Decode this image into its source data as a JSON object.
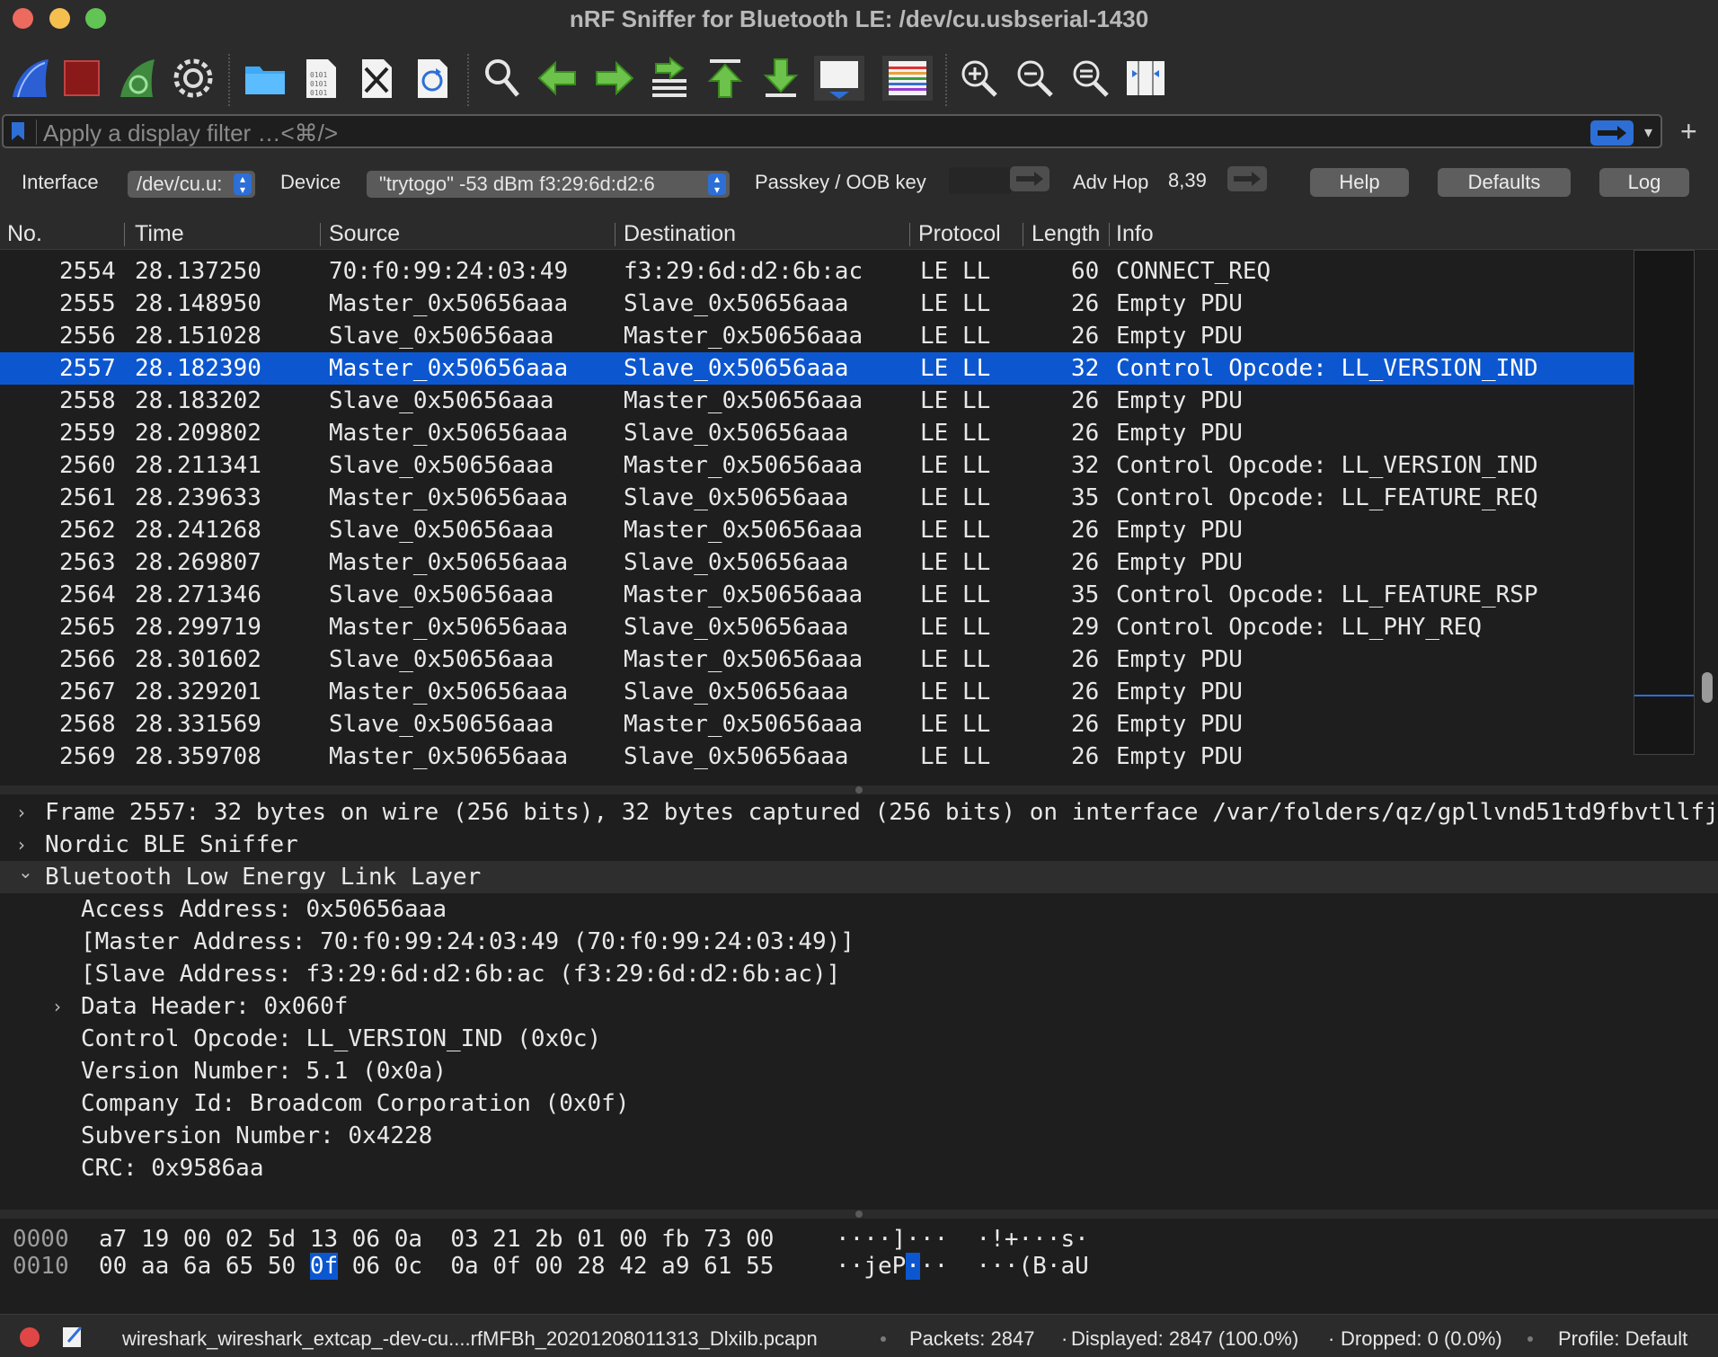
{
  "window": {
    "title": "nRF Sniffer for Bluetooth LE: /dev/cu.usbserial-1430"
  },
  "toolbar": {
    "icons": [
      "shark-fin-start-icon",
      "stop-icon",
      "restart-icon",
      "gear-icon",
      "folder-open-icon",
      "save-file-icon",
      "close-file-icon",
      "reload-icon",
      "search-icon",
      "back-arrow-icon",
      "forward-arrow-icon",
      "go-to-packet-icon",
      "first-packet-icon",
      "last-packet-icon",
      "autoscroll-icon",
      "colorize-icon",
      "zoom-in-icon",
      "zoom-out-icon",
      "zoom-reset-icon",
      "resize-columns-icon"
    ]
  },
  "filter": {
    "placeholder": "Apply a display filter …<⌘/>",
    "dropdown": "▾",
    "plus": "+"
  },
  "capture": {
    "interface_label": "Interface",
    "interface_value": "/dev/cu.u:",
    "device_label": "Device",
    "device_value": "\"trytogo\"  -53 dBm  f3:29:6d:d2:6",
    "passkey_label": "Passkey / OOB key",
    "advhop_label": "Adv Hop",
    "advhop_value": "8,39",
    "help_label": "Help",
    "defaults_label": "Defaults",
    "log_label": "Log"
  },
  "packet_list": {
    "columns": [
      "No.",
      "Time",
      "Source",
      "Destination",
      "Protocol",
      "Length",
      "Info"
    ],
    "rows": [
      {
        "no": "2554",
        "time": "28.137250",
        "source": "70:f0:99:24:03:49",
        "destination": "f3:29:6d:d2:6b:ac",
        "protocol": "LE LL",
        "length": "60",
        "info": "CONNECT_REQ"
      },
      {
        "no": "2555",
        "time": "28.148950",
        "source": "Master_0x50656aaa",
        "destination": "Slave_0x50656aaa",
        "protocol": "LE LL",
        "length": "26",
        "info": "Empty PDU"
      },
      {
        "no": "2556",
        "time": "28.151028",
        "source": "Slave_0x50656aaa",
        "destination": "Master_0x50656aaa",
        "protocol": "LE LL",
        "length": "26",
        "info": "Empty PDU"
      },
      {
        "no": "2557",
        "time": "28.182390",
        "source": "Master_0x50656aaa",
        "destination": "Slave_0x50656aaa",
        "protocol": "LE LL",
        "length": "32",
        "info": "Control Opcode: LL_VERSION_IND",
        "selected": true
      },
      {
        "no": "2558",
        "time": "28.183202",
        "source": "Slave_0x50656aaa",
        "destination": "Master_0x50656aaa",
        "protocol": "LE LL",
        "length": "26",
        "info": "Empty PDU"
      },
      {
        "no": "2559",
        "time": "28.209802",
        "source": "Master_0x50656aaa",
        "destination": "Slave_0x50656aaa",
        "protocol": "LE LL",
        "length": "26",
        "info": "Empty PDU"
      },
      {
        "no": "2560",
        "time": "28.211341",
        "source": "Slave_0x50656aaa",
        "destination": "Master_0x50656aaa",
        "protocol": "LE LL",
        "length": "32",
        "info": "Control Opcode: LL_VERSION_IND"
      },
      {
        "no": "2561",
        "time": "28.239633",
        "source": "Master_0x50656aaa",
        "destination": "Slave_0x50656aaa",
        "protocol": "LE LL",
        "length": "35",
        "info": "Control Opcode: LL_FEATURE_REQ"
      },
      {
        "no": "2562",
        "time": "28.241268",
        "source": "Slave_0x50656aaa",
        "destination": "Master_0x50656aaa",
        "protocol": "LE LL",
        "length": "26",
        "info": "Empty PDU"
      },
      {
        "no": "2563",
        "time": "28.269807",
        "source": "Master_0x50656aaa",
        "destination": "Slave_0x50656aaa",
        "protocol": "LE LL",
        "length": "26",
        "info": "Empty PDU"
      },
      {
        "no": "2564",
        "time": "28.271346",
        "source": "Slave_0x50656aaa",
        "destination": "Master_0x50656aaa",
        "protocol": "LE LL",
        "length": "35",
        "info": "Control Opcode: LL_FEATURE_RSP"
      },
      {
        "no": "2565",
        "time": "28.299719",
        "source": "Master_0x50656aaa",
        "destination": "Slave_0x50656aaa",
        "protocol": "LE LL",
        "length": "29",
        "info": "Control Opcode: LL_PHY_REQ"
      },
      {
        "no": "2566",
        "time": "28.301602",
        "source": "Slave_0x50656aaa",
        "destination": "Master_0x50656aaa",
        "protocol": "LE LL",
        "length": "26",
        "info": "Empty PDU"
      },
      {
        "no": "2567",
        "time": "28.329201",
        "source": "Master_0x50656aaa",
        "destination": "Slave_0x50656aaa",
        "protocol": "LE LL",
        "length": "26",
        "info": "Empty PDU"
      },
      {
        "no": "2568",
        "time": "28.331569",
        "source": "Slave_0x50656aaa",
        "destination": "Master_0x50656aaa",
        "protocol": "LE LL",
        "length": "26",
        "info": "Empty PDU"
      },
      {
        "no": "2569",
        "time": "28.359708",
        "source": "Master_0x50656aaa",
        "destination": "Slave_0x50656aaa",
        "protocol": "LE LL",
        "length": "26",
        "info": "Empty PDU"
      }
    ]
  },
  "details": [
    {
      "text": "Frame 2557: 32 bytes on wire (256 bits), 32 bytes captured (256 bits) on interface /var/folders/qz/gpllvnd51td9fbvtllfj",
      "indent": 0,
      "chevron": "›",
      "highlight": false
    },
    {
      "text": "Nordic BLE Sniffer",
      "indent": 0,
      "chevron": "›",
      "highlight": false
    },
    {
      "text": "Bluetooth Low Energy Link Layer",
      "indent": 0,
      "chevron": "⌄",
      "highlight": true
    },
    {
      "text": "Access Address: 0x50656aaa",
      "indent": 1,
      "chevron": "",
      "highlight": false
    },
    {
      "text": "[Master Address: 70:f0:99:24:03:49 (70:f0:99:24:03:49)]",
      "indent": 1,
      "chevron": "",
      "highlight": false
    },
    {
      "text": "[Slave Address: f3:29:6d:d2:6b:ac (f3:29:6d:d2:6b:ac)]",
      "indent": 1,
      "chevron": "",
      "highlight": false
    },
    {
      "text": "Data Header: 0x060f",
      "indent": 1,
      "chevron": "›",
      "highlight": false
    },
    {
      "text": "Control Opcode: LL_VERSION_IND (0x0c)",
      "indent": 1,
      "chevron": "",
      "highlight": false
    },
    {
      "text": "Version Number: 5.1 (0x0a)",
      "indent": 1,
      "chevron": "",
      "highlight": false
    },
    {
      "text": "Company Id: Broadcom Corporation (0x0f)",
      "indent": 1,
      "chevron": "",
      "highlight": false
    },
    {
      "text": "Subversion Number: 0x4228",
      "indent": 1,
      "chevron": "",
      "highlight": false
    },
    {
      "text": "CRC: 0x9586aa",
      "indent": 1,
      "chevron": "",
      "highlight": false
    }
  ],
  "hex": {
    "rows": [
      {
        "offset": "0000",
        "bytes_a": "a7 19 00 02 5d 13 06 0a",
        "bytes_b": "03 21 2b 01 00 fb 73 00",
        "ascii_pre": "····]···  ·!+···s·",
        "ascii_hl": "",
        "ascii_post": ""
      },
      {
        "offset": "0010",
        "bytes_a_pre": "00 aa 6a 65 50 ",
        "bytes_a_hl": "0f",
        "bytes_a_post": " 06 0c",
        "bytes_b": "0a 0f 00 28 42 a9 61 55",
        "ascii_pre": "··jeP",
        "ascii_hl": "·",
        "ascii_post": "··  ···(B·aU"
      }
    ]
  },
  "status": {
    "file": "wireshark_wireshark_extcap_-dev-cu....rfMFBh_20201208011313_Dlxilb.pcapn",
    "packets": "Packets: 2847",
    "displayed": "Displayed: 2847 (100.0%)",
    "dropped": "Dropped: 0 (0.0%)",
    "profile": "Profile: Default",
    "sep": "·"
  },
  "colors": {
    "selection": "#0c57d0",
    "accent": "#2d6fd6",
    "background": "#1e1e1e",
    "chrome": "#2b2b2b"
  }
}
